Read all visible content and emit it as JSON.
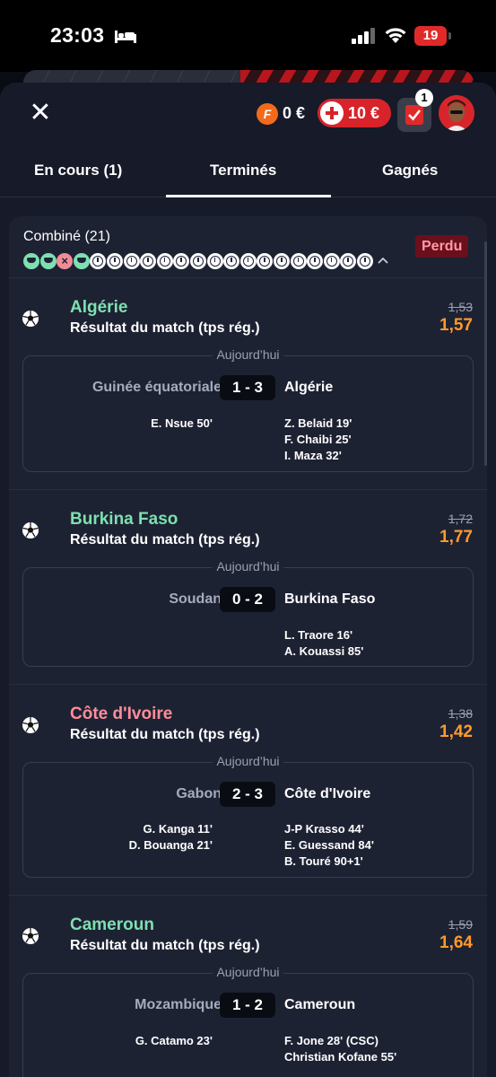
{
  "status_bar": {
    "time": "23:03",
    "battery": "19"
  },
  "header": {
    "close_icon": "close-icon",
    "balance": "0 €",
    "coin_letter": "F",
    "deposit_label": "10 €",
    "betslip_count": "1"
  },
  "tabs": [
    {
      "label": "En cours (1)",
      "active": false
    },
    {
      "label": "Terminés",
      "active": true
    },
    {
      "label": "Gagnés",
      "active": false
    }
  ],
  "bet": {
    "title": "Combiné (21)",
    "status": "Perdu",
    "legs": [
      "won",
      "won",
      "lost",
      "won",
      "pending",
      "pending",
      "pending",
      "pending",
      "pending",
      "pending",
      "pending",
      "pending",
      "pending",
      "pending",
      "pending",
      "pending",
      "pending",
      "pending",
      "pending",
      "pending",
      "pending"
    ],
    "lost_mark": "×",
    "selections": [
      {
        "team": "Algérie",
        "result": "won",
        "market": "Résultat du match (tps rég.)",
        "old_odds": "1,53",
        "odds": "1,57",
        "date": "Aujourd’hui",
        "home": "Guinée équatoriale",
        "score": "1 - 3",
        "away": "Algérie",
        "home_scorers": "E. Nsue 50'",
        "away_scorers": [
          "Z. Belaid 19'",
          "F. Chaibi 25'",
          "I. Maza 32'"
        ]
      },
      {
        "team": "Burkina Faso",
        "result": "won",
        "market": "Résultat du match (tps rég.)",
        "old_odds": "1,72",
        "odds": "1,77",
        "date": "Aujourd’hui",
        "home": "Soudan",
        "score": "0 - 2",
        "away": "Burkina Faso",
        "home_scorers": "",
        "away_scorers": [
          "L. Traore 16'",
          "A. Kouassi  85'"
        ]
      },
      {
        "team": "Côte d'Ivoire",
        "result": "lost",
        "market": "Résultat du match (tps rég.)",
        "old_odds": "1,38",
        "odds": "1,42",
        "date": "Aujourd’hui",
        "home": "Gabon",
        "score": "2 - 3",
        "away": "Côte d'Ivoire",
        "home_scorers_list": [
          "G. Kanga 11'",
          "D. Bouanga 21'"
        ],
        "away_scorers": [
          "J-P Krasso 44'",
          "E. Guessand 84'",
          "B. Touré 90+1'"
        ]
      },
      {
        "team": "Cameroun",
        "result": "won",
        "market": "Résultat du match (tps rég.)",
        "old_odds": "1,59",
        "odds": "1,64",
        "date": "Aujourd’hui",
        "home": "Mozambique",
        "score": "1 - 2",
        "away": "Cameroun",
        "home_scorers": "G. Catamo 23'",
        "away_scorers": [
          "F. Jone 28' (CSC)",
          "Christian Kofane 55'"
        ]
      }
    ]
  },
  "colors": {
    "won": "#7ee0b0",
    "lost": "#ff8d9a",
    "odds": "#ff9a2a",
    "accent": "#d8232a"
  }
}
